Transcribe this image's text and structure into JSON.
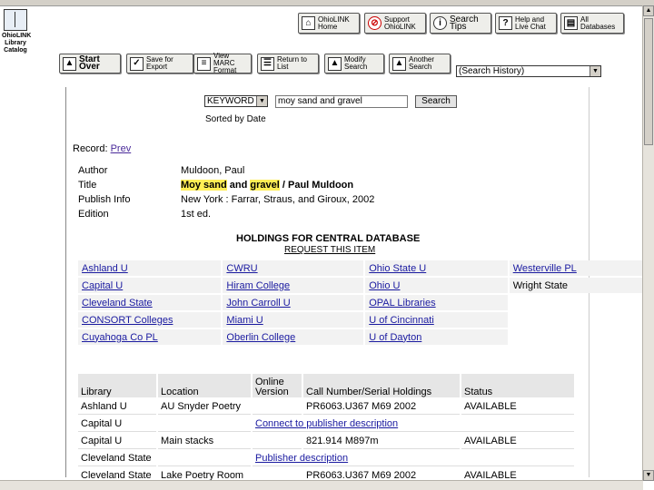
{
  "sidebar": {
    "logo_text": "OhioLINK Library Catalog"
  },
  "top_buttons": [
    {
      "label": "OhioLINK\nHome",
      "icon": "home-icon",
      "glyph": "⌂"
    },
    {
      "label": "Support\nOhioLINK",
      "icon": "no-icon",
      "glyph": "⊘"
    },
    {
      "label": "Search Tips",
      "icon": "info-icon",
      "glyph": "i"
    },
    {
      "label": "Help and\nLive Chat",
      "icon": "question-icon",
      "glyph": "?"
    },
    {
      "label": "All\nDatabases",
      "icon": "databases-icon",
      "glyph": "▤"
    }
  ],
  "toolbar": [
    {
      "label": "Start Over",
      "icon": "arrow-up-icon",
      "glyph": "▲"
    },
    {
      "label": "Save for\nExport",
      "icon": "checkbox-icon",
      "glyph": "✓"
    },
    {
      "label": "View\nMARC Format",
      "icon": "document-icon",
      "glyph": "≡"
    },
    {
      "label": "Return to\nList",
      "icon": "list-icon",
      "glyph": "☰"
    },
    {
      "label": "Modify\nSearch",
      "icon": "modify-arrow-icon",
      "glyph": "▲"
    },
    {
      "label": "Another\nSearch",
      "icon": "another-arrow-icon",
      "glyph": "▲"
    }
  ],
  "search_history": {
    "selected": "(Search History)"
  },
  "search": {
    "type_selected": "KEYWORD",
    "query": "moy sand and gravel",
    "button": "Search",
    "sorted": "Sorted by Date"
  },
  "record": {
    "label": "Record:",
    "prev": "Prev"
  },
  "fields": {
    "author_label": "Author",
    "author_value": "Muldoon, Paul",
    "title_label": "Title",
    "title_p1": "Moy sand",
    "title_p2": " and ",
    "title_p3": "gravel",
    "title_p4": " / Paul Muldoon",
    "pub_label": "Publish Info",
    "pub_value": "New York : Farrar, Straus, and Giroux, 2002",
    "edition_label": "Edition",
    "edition_value": "1st ed."
  },
  "holdings_title": "HOLDINGS FOR CENTRAL DATABASE",
  "request_link": "REQUEST THIS ITEM",
  "libraries": [
    [
      "Ashland U",
      "CWRU",
      "Ohio State U",
      "Westerville PL"
    ],
    [
      "Capital U",
      "Hiram College",
      "Ohio U",
      "Wright State"
    ],
    [
      "Cleveland State",
      "John Carroll U",
      "OPAL Libraries",
      ""
    ],
    [
      "CONSORT Colleges",
      "Miami U",
      "U of Cincinnati",
      ""
    ],
    [
      "Cuyahoga Co PL",
      "Oberlin College",
      "U of Dayton",
      ""
    ]
  ],
  "holdings_table": {
    "headers": [
      "Library",
      "Location",
      "Online\nVersion",
      "Call Number/Serial Holdings",
      "Status"
    ],
    "rows": [
      {
        "library": "Ashland U",
        "location": "AU Snyder Poetry",
        "online": "",
        "call": "PR6063.U367 M69 2002",
        "status": "AVAILABLE"
      },
      {
        "library": "Capital U",
        "location": "",
        "online": "Connect to publisher description",
        "call": "",
        "status": ""
      },
      {
        "library": "Capital U",
        "location": "Main stacks",
        "online": "",
        "call": "821.914 M897m",
        "status": "AVAILABLE"
      },
      {
        "library": "Cleveland State",
        "location": "",
        "online": "Publisher description",
        "call": "",
        "status": ""
      },
      {
        "library": "Cleveland State",
        "location": "Lake Poetry Room",
        "online": "",
        "call": "PR6063.U367 M69 2002",
        "status": "AVAILABLE"
      }
    ]
  }
}
